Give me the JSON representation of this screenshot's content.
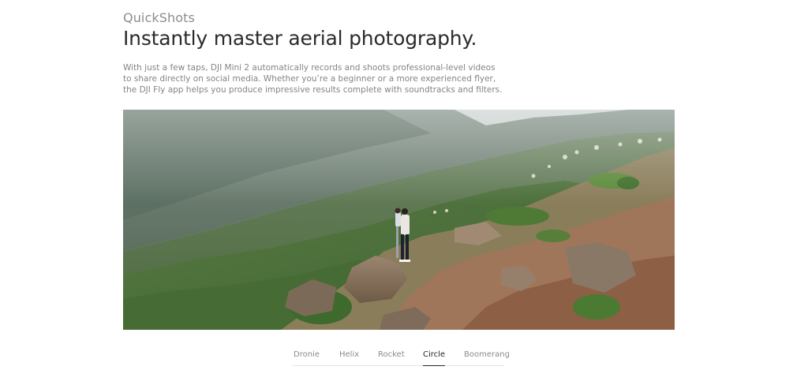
{
  "section": {
    "label": "QuickShots",
    "headline": "Instantly master aerial photography."
  },
  "description": {
    "line1": "With just a few taps, DJI Mini 2 automatically records and shoots professional-level videos",
    "line2": "to share directly on social media. Whether you’re a beginner or a more experienced flyer,",
    "line3": "the DJI Fly app helps you produce impressive results complete with soundtracks and filters."
  },
  "tabs": [
    {
      "label": "Dronie",
      "active": false
    },
    {
      "label": "Helix",
      "active": false
    },
    {
      "label": "Rocket",
      "active": false
    },
    {
      "label": "Circle",
      "active": true
    },
    {
      "label": "Boomerang",
      "active": false
    }
  ],
  "colors": {
    "text_primary": "#2b2b2b",
    "text_secondary": "#8d8d8d",
    "tab_active": "#262626",
    "tab_inactive": "#8a8a8a"
  }
}
